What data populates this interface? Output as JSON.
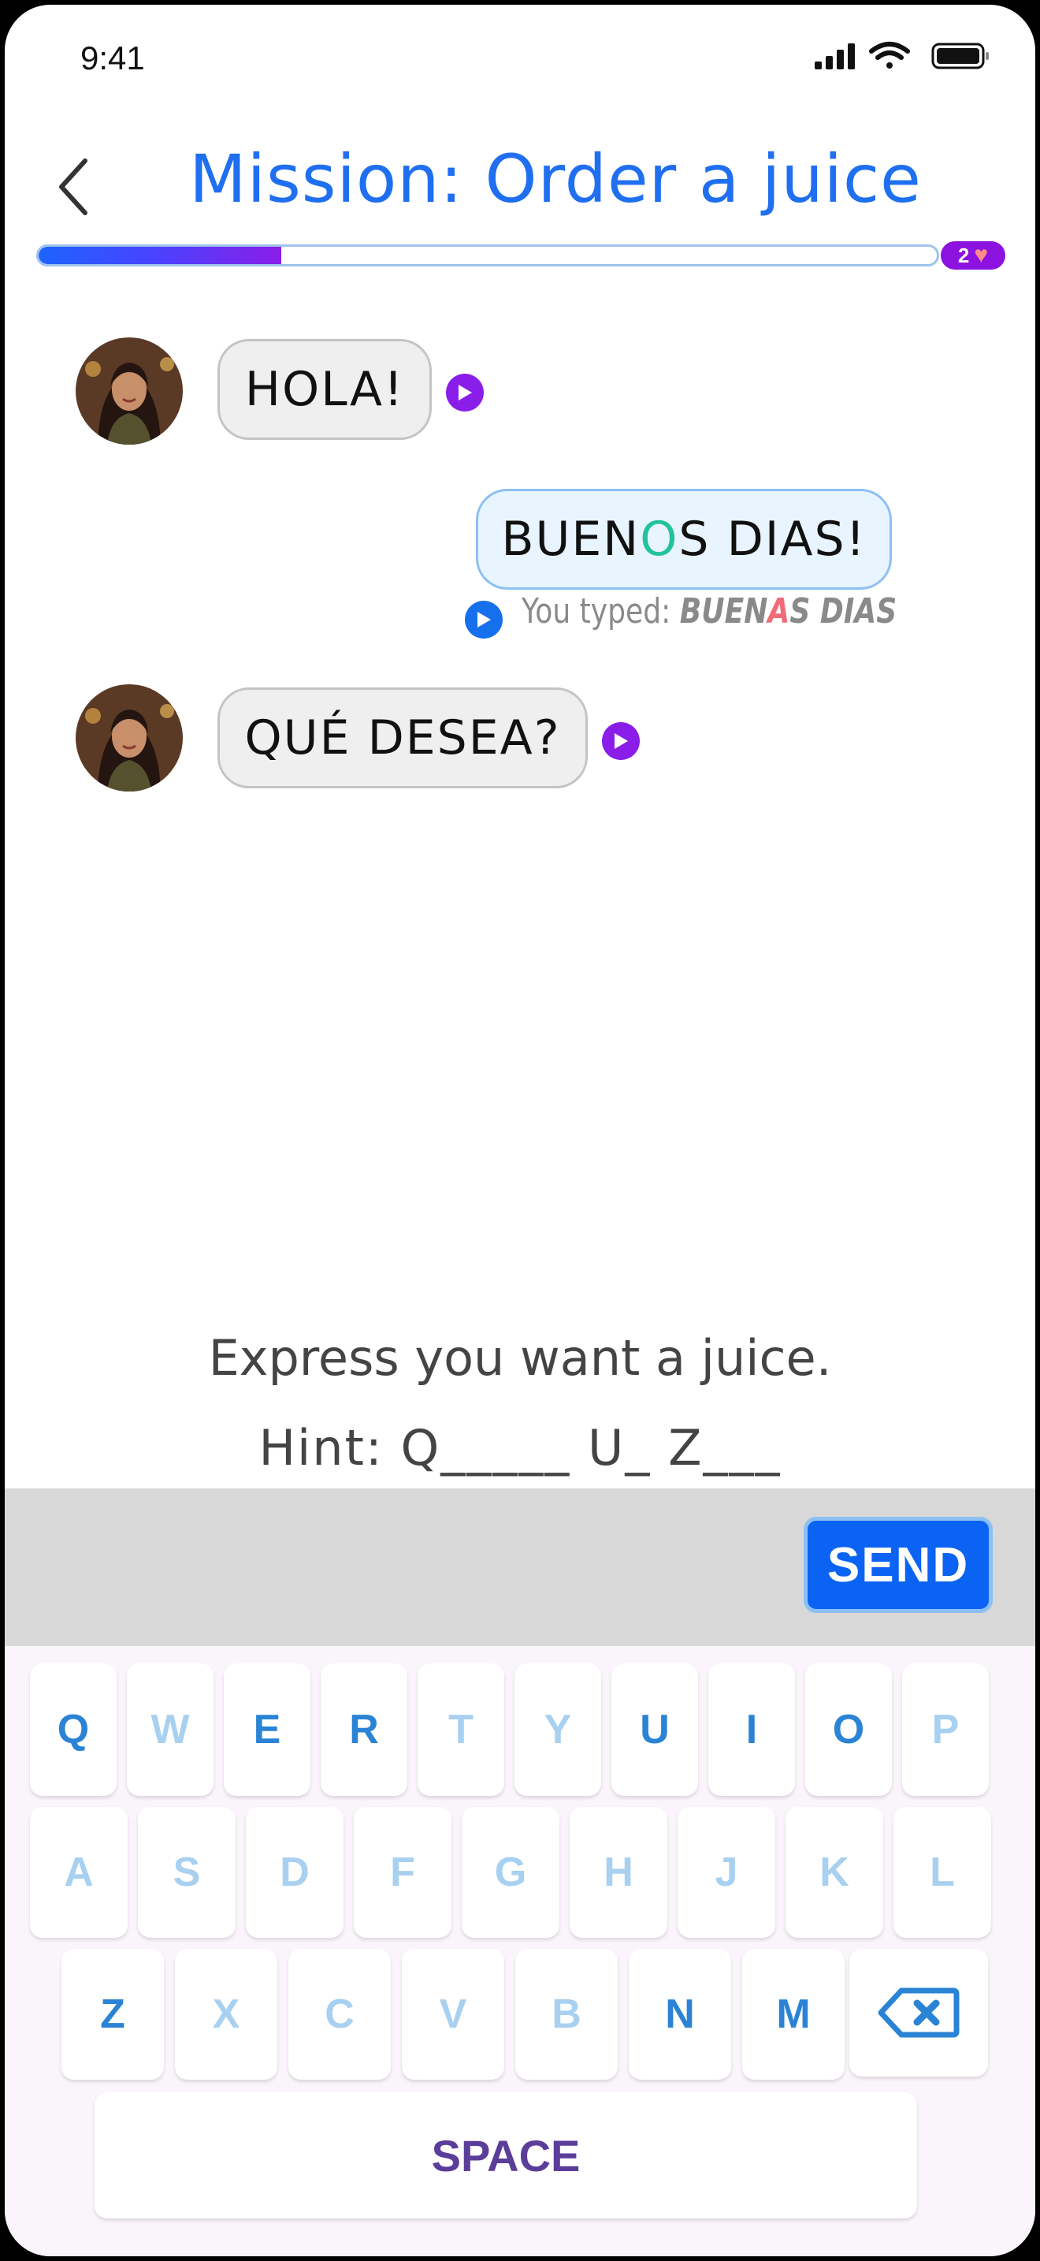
{
  "status_bar": {
    "time": "9:41"
  },
  "header": {
    "title": "Mission: Order a juice"
  },
  "progress": {
    "fraction": 0.27,
    "hearts": "2"
  },
  "messages": [
    {
      "from": "npc",
      "text": "HOLA!"
    },
    {
      "from": "user",
      "text_before": "BUEN",
      "text_highlight": "O",
      "text_after": "S DIAS!",
      "typed_label": "You typed: ",
      "typed_before": "BUEN",
      "typed_error": "A",
      "typed_after": "S DIAS"
    },
    {
      "from": "npc",
      "text": "QUÉ DESEA?"
    }
  ],
  "prompt": "Express you want a juice.",
  "hint": "Hint: Q_____ U_ Z___",
  "send_label": "SEND",
  "keyboard": {
    "rows": [
      [
        "Q",
        "W",
        "E",
        "R",
        "T",
        "Y",
        "U",
        "I",
        "O",
        "P"
      ],
      [
        "A",
        "S",
        "D",
        "F",
        "G",
        "H",
        "J",
        "K",
        "L"
      ],
      [
        "Z",
        "X",
        "C",
        "V",
        "B",
        "N",
        "M"
      ]
    ],
    "active_keys": [
      "Q",
      "E",
      "R",
      "U",
      "I",
      "O",
      "Z",
      "N",
      "M"
    ],
    "space_label": "SPACE"
  },
  "colors": {
    "accent": "#1f6ff0",
    "purple": "#8a1ee8",
    "correct": "#22c39a",
    "error": "#f06b78"
  }
}
